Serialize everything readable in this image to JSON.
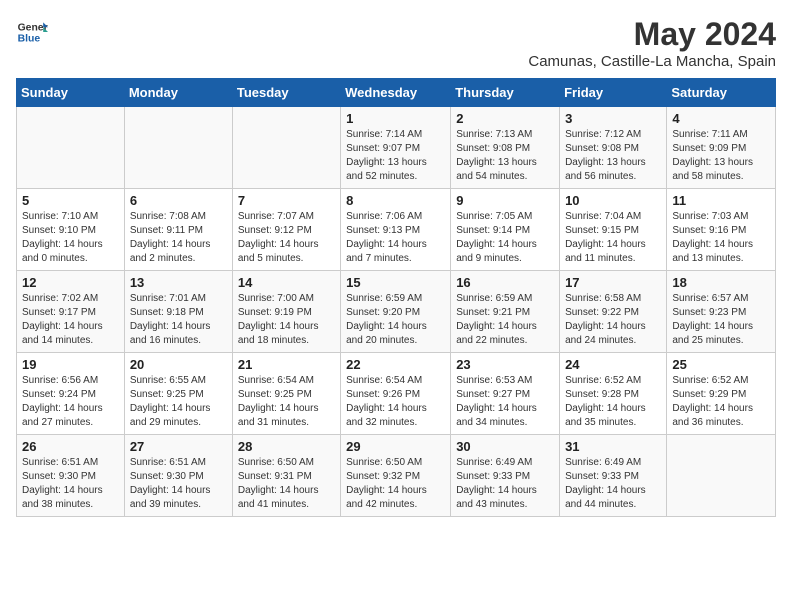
{
  "header": {
    "logo_line1": "General",
    "logo_line2": "Blue",
    "month_year": "May 2024",
    "location": "Camunas, Castille-La Mancha, Spain"
  },
  "weekdays": [
    "Sunday",
    "Monday",
    "Tuesday",
    "Wednesday",
    "Thursday",
    "Friday",
    "Saturday"
  ],
  "weeks": [
    [
      {
        "day": "",
        "sunrise": "",
        "sunset": "",
        "daylight": ""
      },
      {
        "day": "",
        "sunrise": "",
        "sunset": "",
        "daylight": ""
      },
      {
        "day": "",
        "sunrise": "",
        "sunset": "",
        "daylight": ""
      },
      {
        "day": "1",
        "sunrise": "Sunrise: 7:14 AM",
        "sunset": "Sunset: 9:07 PM",
        "daylight": "Daylight: 13 hours and 52 minutes."
      },
      {
        "day": "2",
        "sunrise": "Sunrise: 7:13 AM",
        "sunset": "Sunset: 9:08 PM",
        "daylight": "Daylight: 13 hours and 54 minutes."
      },
      {
        "day": "3",
        "sunrise": "Sunrise: 7:12 AM",
        "sunset": "Sunset: 9:08 PM",
        "daylight": "Daylight: 13 hours and 56 minutes."
      },
      {
        "day": "4",
        "sunrise": "Sunrise: 7:11 AM",
        "sunset": "Sunset: 9:09 PM",
        "daylight": "Daylight: 13 hours and 58 minutes."
      }
    ],
    [
      {
        "day": "5",
        "sunrise": "Sunrise: 7:10 AM",
        "sunset": "Sunset: 9:10 PM",
        "daylight": "Daylight: 14 hours and 0 minutes."
      },
      {
        "day": "6",
        "sunrise": "Sunrise: 7:08 AM",
        "sunset": "Sunset: 9:11 PM",
        "daylight": "Daylight: 14 hours and 2 minutes."
      },
      {
        "day": "7",
        "sunrise": "Sunrise: 7:07 AM",
        "sunset": "Sunset: 9:12 PM",
        "daylight": "Daylight: 14 hours and 5 minutes."
      },
      {
        "day": "8",
        "sunrise": "Sunrise: 7:06 AM",
        "sunset": "Sunset: 9:13 PM",
        "daylight": "Daylight: 14 hours and 7 minutes."
      },
      {
        "day": "9",
        "sunrise": "Sunrise: 7:05 AM",
        "sunset": "Sunset: 9:14 PM",
        "daylight": "Daylight: 14 hours and 9 minutes."
      },
      {
        "day": "10",
        "sunrise": "Sunrise: 7:04 AM",
        "sunset": "Sunset: 9:15 PM",
        "daylight": "Daylight: 14 hours and 11 minutes."
      },
      {
        "day": "11",
        "sunrise": "Sunrise: 7:03 AM",
        "sunset": "Sunset: 9:16 PM",
        "daylight": "Daylight: 14 hours and 13 minutes."
      }
    ],
    [
      {
        "day": "12",
        "sunrise": "Sunrise: 7:02 AM",
        "sunset": "Sunset: 9:17 PM",
        "daylight": "Daylight: 14 hours and 14 minutes."
      },
      {
        "day": "13",
        "sunrise": "Sunrise: 7:01 AM",
        "sunset": "Sunset: 9:18 PM",
        "daylight": "Daylight: 14 hours and 16 minutes."
      },
      {
        "day": "14",
        "sunrise": "Sunrise: 7:00 AM",
        "sunset": "Sunset: 9:19 PM",
        "daylight": "Daylight: 14 hours and 18 minutes."
      },
      {
        "day": "15",
        "sunrise": "Sunrise: 6:59 AM",
        "sunset": "Sunset: 9:20 PM",
        "daylight": "Daylight: 14 hours and 20 minutes."
      },
      {
        "day": "16",
        "sunrise": "Sunrise: 6:59 AM",
        "sunset": "Sunset: 9:21 PM",
        "daylight": "Daylight: 14 hours and 22 minutes."
      },
      {
        "day": "17",
        "sunrise": "Sunrise: 6:58 AM",
        "sunset": "Sunset: 9:22 PM",
        "daylight": "Daylight: 14 hours and 24 minutes."
      },
      {
        "day": "18",
        "sunrise": "Sunrise: 6:57 AM",
        "sunset": "Sunset: 9:23 PM",
        "daylight": "Daylight: 14 hours and 25 minutes."
      }
    ],
    [
      {
        "day": "19",
        "sunrise": "Sunrise: 6:56 AM",
        "sunset": "Sunset: 9:24 PM",
        "daylight": "Daylight: 14 hours and 27 minutes."
      },
      {
        "day": "20",
        "sunrise": "Sunrise: 6:55 AM",
        "sunset": "Sunset: 9:25 PM",
        "daylight": "Daylight: 14 hours and 29 minutes."
      },
      {
        "day": "21",
        "sunrise": "Sunrise: 6:54 AM",
        "sunset": "Sunset: 9:25 PM",
        "daylight": "Daylight: 14 hours and 31 minutes."
      },
      {
        "day": "22",
        "sunrise": "Sunrise: 6:54 AM",
        "sunset": "Sunset: 9:26 PM",
        "daylight": "Daylight: 14 hours and 32 minutes."
      },
      {
        "day": "23",
        "sunrise": "Sunrise: 6:53 AM",
        "sunset": "Sunset: 9:27 PM",
        "daylight": "Daylight: 14 hours and 34 minutes."
      },
      {
        "day": "24",
        "sunrise": "Sunrise: 6:52 AM",
        "sunset": "Sunset: 9:28 PM",
        "daylight": "Daylight: 14 hours and 35 minutes."
      },
      {
        "day": "25",
        "sunrise": "Sunrise: 6:52 AM",
        "sunset": "Sunset: 9:29 PM",
        "daylight": "Daylight: 14 hours and 36 minutes."
      }
    ],
    [
      {
        "day": "26",
        "sunrise": "Sunrise: 6:51 AM",
        "sunset": "Sunset: 9:30 PM",
        "daylight": "Daylight: 14 hours and 38 minutes."
      },
      {
        "day": "27",
        "sunrise": "Sunrise: 6:51 AM",
        "sunset": "Sunset: 9:30 PM",
        "daylight": "Daylight: 14 hours and 39 minutes."
      },
      {
        "day": "28",
        "sunrise": "Sunrise: 6:50 AM",
        "sunset": "Sunset: 9:31 PM",
        "daylight": "Daylight: 14 hours and 41 minutes."
      },
      {
        "day": "29",
        "sunrise": "Sunrise: 6:50 AM",
        "sunset": "Sunset: 9:32 PM",
        "daylight": "Daylight: 14 hours and 42 minutes."
      },
      {
        "day": "30",
        "sunrise": "Sunrise: 6:49 AM",
        "sunset": "Sunset: 9:33 PM",
        "daylight": "Daylight: 14 hours and 43 minutes."
      },
      {
        "day": "31",
        "sunrise": "Sunrise: 6:49 AM",
        "sunset": "Sunset: 9:33 PM",
        "daylight": "Daylight: 14 hours and 44 minutes."
      },
      {
        "day": "",
        "sunrise": "",
        "sunset": "",
        "daylight": ""
      }
    ]
  ]
}
